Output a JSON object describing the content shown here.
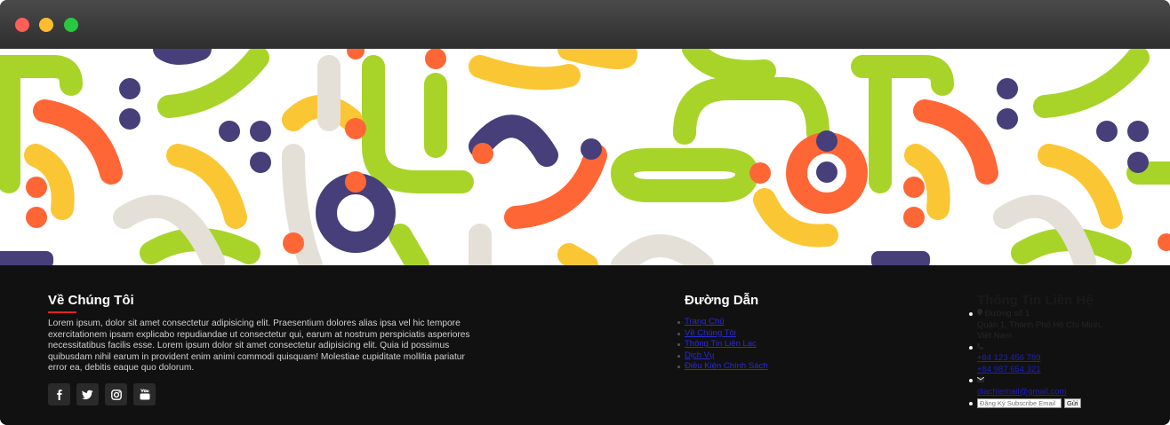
{
  "window": {
    "controls": [
      "close",
      "minimize",
      "maximize"
    ]
  },
  "banner": {
    "colors": {
      "green": "#a8d42a",
      "yellow": "#fbc634",
      "orange": "#ff6636",
      "navy": "#463f7a",
      "beige": "#e4e0d8"
    }
  },
  "about": {
    "title": "Về Chúng Tôi",
    "text": "Lorem ipsum, dolor sit amet consectetur adipisicing elit. Praesentium dolores alias ipsa vel hic tempore exercitationem ipsam explicabo repudiandae ut consectetur qui, earum at nostrum perspiciatis asperiores necessitatibus facilis esse. Lorem ipsum dolor sit amet consectetur adipisicing elit. Quia id possimus quibusdam nihil earum in provident enim animi commodi quisquam! Molestiae cupiditate mollitia pariatur error ea, debitis eaque quo dolorum.",
    "accent": "#e02424",
    "socials": [
      "facebook-icon",
      "twitter-icon",
      "instagram-icon",
      "youtube-icon"
    ]
  },
  "links": {
    "title": "Đường Dẫn",
    "items": [
      "Trang Chủ",
      "Về Chúng Tôi",
      "Thông Tin Liên Lạc",
      "Dịch Vụ",
      "Điều Kiện Chính Sách"
    ]
  },
  "contact": {
    "title": "Thông Tin Liên Hệ",
    "address_line1": "Đường số 1",
    "address_line2": "Quận 1, Thành Phố Hồ Chí Minh,",
    "address_line3": "Việt Nam",
    "phone1": "+84 123 456 789",
    "phone2": "+84 987 654 321",
    "email": "diachiemail@gmail.com",
    "subscribe_placeholder": "Đăng Ký Subscribe Email",
    "subscribe_button": "Gửi"
  }
}
